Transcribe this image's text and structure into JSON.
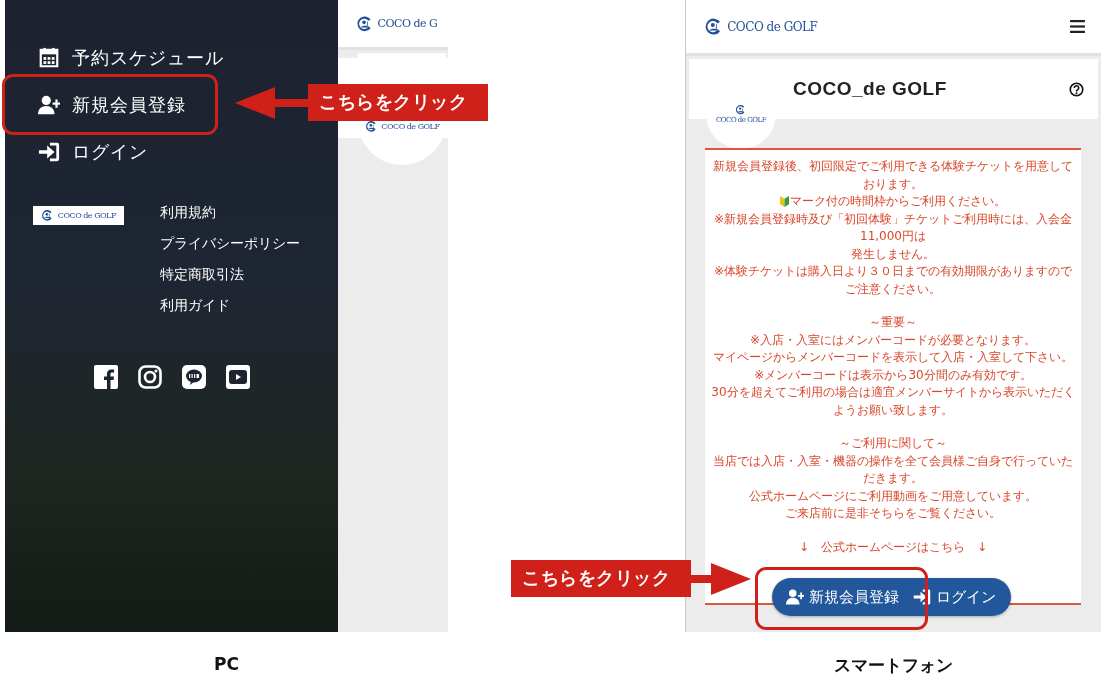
{
  "pc": {
    "menu": [
      {
        "kind": "schedule",
        "label": "予約スケジュール"
      },
      {
        "kind": "register",
        "label": "新規会員登録"
      },
      {
        "kind": "login",
        "label": "ログイン"
      }
    ],
    "footer_logo": "COCO de GOLF",
    "footer_links": [
      "利用規約",
      "プライバシーポリシー",
      "特定商取引法",
      "利用ガイド"
    ],
    "social": [
      {
        "kind": "facebook"
      },
      {
        "kind": "instagram"
      },
      {
        "kind": "line"
      },
      {
        "kind": "youtube"
      }
    ],
    "header_logo": "COCO de G",
    "avatar_logo": "COCO de GOLF",
    "caption": "PC"
  },
  "phone": {
    "header_logo": "COCO de GOLF",
    "shop_name": "COCO_de GOLF",
    "avatar_logo": "COCO de GOLF",
    "notice": [
      [
        {
          "kind": "plain",
          "text": "新規会員登録後、初回限定でご利用できる体験チケットを用意しております。"
        },
        {
          "kind": "mark",
          "text": "マーク付の時間枠からご利用ください。"
        },
        {
          "kind": "plain",
          "text": "※新規会員登録時及び「初回体験」チケットご利用時には、入会金11,000円は"
        },
        {
          "kind": "plain",
          "text": "発生しません。"
        },
        {
          "kind": "plain",
          "text": "※体験チケットは購入日より３０日までの有効期限がありますのでご注意ください。"
        }
      ],
      [
        {
          "kind": "plain",
          "text": "～重要～"
        },
        {
          "kind": "plain",
          "text": "※入店・入室にはメンバーコードが必要となります。"
        },
        {
          "kind": "plain",
          "text": "マイページからメンバーコードを表示して入店・入室して下さい。"
        },
        {
          "kind": "plain",
          "text": "※メンバーコードは表示から30分間のみ有効です。"
        },
        {
          "kind": "plain",
          "text": "30分を超えてご利用の場合は適宜メンバーサイトから表示いただくようお願い致します。"
        }
      ],
      [
        {
          "kind": "plain",
          "text": "～ご利用に関して～"
        },
        {
          "kind": "plain",
          "text": "当店では入店・入室・機器の操作を全て会員様ご自身で行っていただきます。"
        },
        {
          "kind": "plain",
          "text": "公式ホームページにご利用動画をご用意しています。"
        },
        {
          "kind": "plain",
          "text": "ご来店前に是非そちらをご覧ください。"
        }
      ],
      [
        {
          "kind": "plain",
          "text": "↓　公式ホームページはこちら　↓"
        }
      ]
    ],
    "buttons": [
      {
        "kind": "register",
        "label": "新規会員登録"
      },
      {
        "kind": "login",
        "label": "ログイン"
      }
    ],
    "caption": "スマートフォン"
  },
  "callouts": [
    {
      "label": "こちらをクリック",
      "kind": "arrow-left"
    },
    {
      "label": "こちらをクリック",
      "kind": "arrow-right"
    }
  ]
}
